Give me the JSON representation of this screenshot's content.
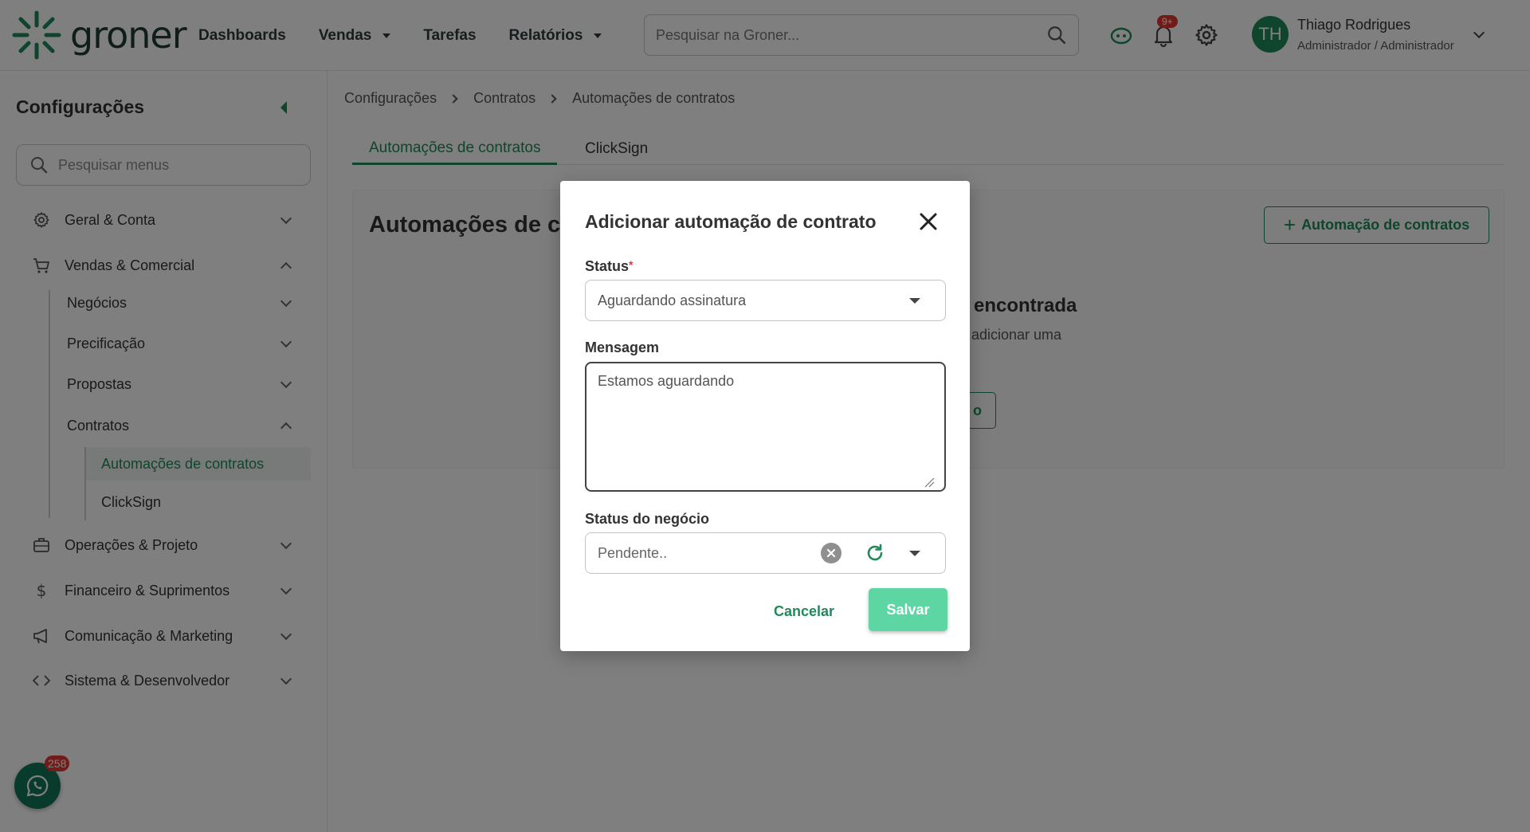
{
  "app": {
    "logo_text": "groner",
    "nav": {
      "dashboards": "Dashboards",
      "vendas": "Vendas",
      "tarefas": "Tarefas",
      "relatorios": "Relatórios"
    },
    "search_placeholder": "Pesquisar na Groner...",
    "notifications_count": "9+",
    "user": {
      "initials": "TH",
      "name": "Thiago Rodrigues",
      "role": "Administrador / Administrador"
    },
    "colors": {
      "accent": "#1f8a5a",
      "save_button": "#5ed6a4",
      "badge": "#e53935"
    }
  },
  "sidebar": {
    "title": "Configurações",
    "search_placeholder": "Pesquisar menus",
    "groups": {
      "geral": "Geral & Conta",
      "vendas": "Vendas & Comercial",
      "negocios": "Negócios",
      "precificacao": "Precificação",
      "propostas": "Propostas",
      "contratos": "Contratos",
      "automacoes": "Automações de contratos",
      "clicksign": "ClickSign",
      "operacoes": "Operações & Projeto",
      "financeiro": "Financeiro & Suprimentos",
      "comunicacao": "Comunicação & Marketing",
      "sistema": "Sistema & Desenvolvedor"
    },
    "whatsapp_badge": "258"
  },
  "main": {
    "breadcrumb": [
      "Configurações",
      "Contratos",
      "Automações de contratos"
    ],
    "tabs": [
      "Automações de contratos",
      "ClickSign"
    ],
    "title_partial": "Automações de co",
    "add_button": "Automação de contratos",
    "empty_title_partial": "encontrada",
    "empty_sub_partial": "adicionar uma",
    "empty_button_partial": "o"
  },
  "modal": {
    "title": "Adicionar automação de contrato",
    "status_label": "Status",
    "required_mark": "*",
    "status_value": "Aguardando assinatura",
    "message_label": "Mensagem",
    "message_value": "Estamos aguardando",
    "business_status_label": "Status do negócio",
    "business_status_value": "Pendente..",
    "cancel": "Cancelar",
    "save": "Salvar"
  }
}
